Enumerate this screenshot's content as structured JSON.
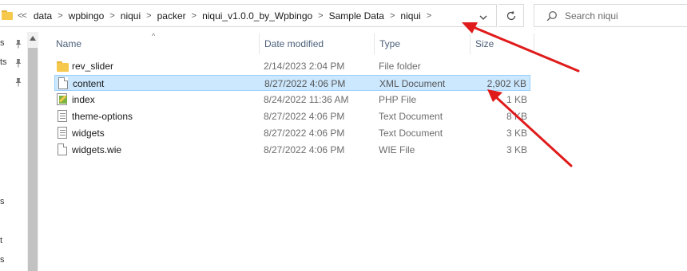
{
  "address_bar": {
    "overflow_label": "<<",
    "breadcrumbs": [
      "data",
      "wpbingo",
      "niqui",
      "packer",
      "niqui_v1.0.0_by_Wpbingo",
      "Sample Data",
      "niqui"
    ],
    "separator": ">"
  },
  "search": {
    "placeholder": "Search niqui"
  },
  "nav_pane": {
    "fragments": [
      "s",
      "ts",
      "s",
      "t",
      "s"
    ]
  },
  "columns": {
    "name": "Name",
    "date": "Date modified",
    "type": "Type",
    "size": "Size"
  },
  "files": [
    {
      "name": "rev_slider",
      "date": "2/14/2023 2:04 PM",
      "type": "File folder",
      "size": "",
      "icon": "folder-icon"
    },
    {
      "name": "content",
      "date": "8/27/2022 4:06 PM",
      "type": "XML Document",
      "size": "2,902 KB",
      "icon": "xml-file-icon",
      "selected": true
    },
    {
      "name": "index",
      "date": "8/24/2022 11:36 AM",
      "type": "PHP File",
      "size": "1 KB",
      "icon": "php-file-icon"
    },
    {
      "name": "theme-options",
      "date": "8/27/2022 4:06 PM",
      "type": "Text Document",
      "size": "8 KB",
      "icon": "text-file-icon"
    },
    {
      "name": "widgets",
      "date": "8/27/2022 4:06 PM",
      "type": "Text Document",
      "size": "3 KB",
      "icon": "text-file-icon"
    },
    {
      "name": "widgets.wie",
      "date": "8/27/2022 4:06 PM",
      "type": "WIE File",
      "size": "3 KB",
      "icon": "file-icon"
    }
  ],
  "colors": {
    "selection_bg": "#cce8ff",
    "selection_border": "#99d1ff",
    "annotation_arrow": "#e01b1b",
    "folder": "#f6c94c"
  }
}
